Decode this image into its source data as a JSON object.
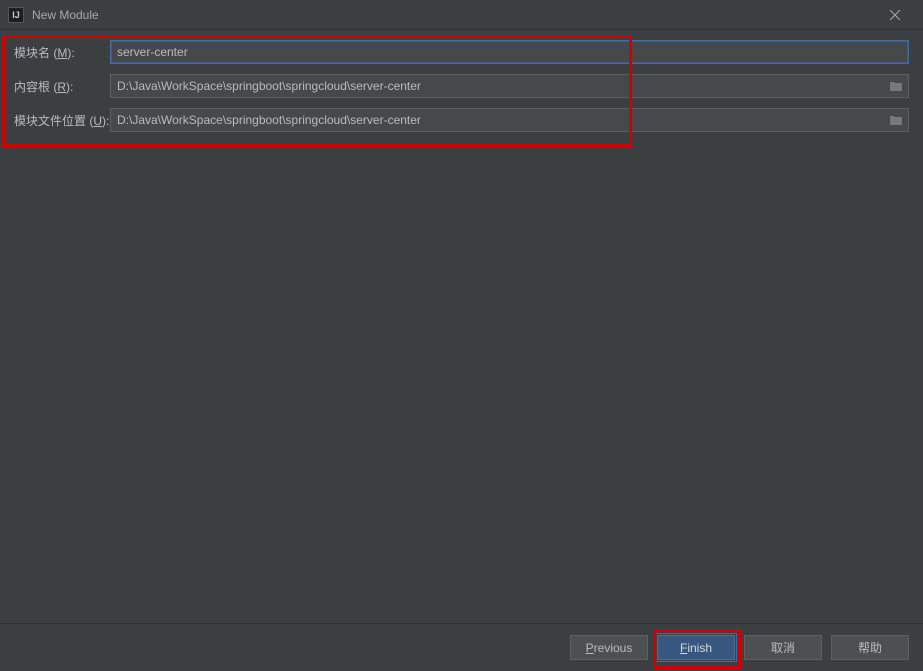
{
  "window": {
    "title": "New Module"
  },
  "form": {
    "moduleName": {
      "labelPrefix": "模块名 (",
      "mnemonic": "M",
      "labelSuffix": "):",
      "value": "server-center"
    },
    "contentRoot": {
      "labelPrefix": "内容根 (",
      "mnemonic": "R",
      "labelSuffix": "):",
      "value": "D:\\Java\\WorkSpace\\springboot\\springcloud\\server-center"
    },
    "moduleFileLocation": {
      "labelPrefix": "模块文件位置 (",
      "mnemonic": "U",
      "labelSuffix": "):",
      "value": "D:\\Java\\WorkSpace\\springboot\\springcloud\\server-center"
    }
  },
  "buttons": {
    "previousMnemonic": "P",
    "previousRest": "revious",
    "finishMnemonic": "F",
    "finishRest": "inish",
    "cancel": "取消",
    "help": "帮助"
  }
}
